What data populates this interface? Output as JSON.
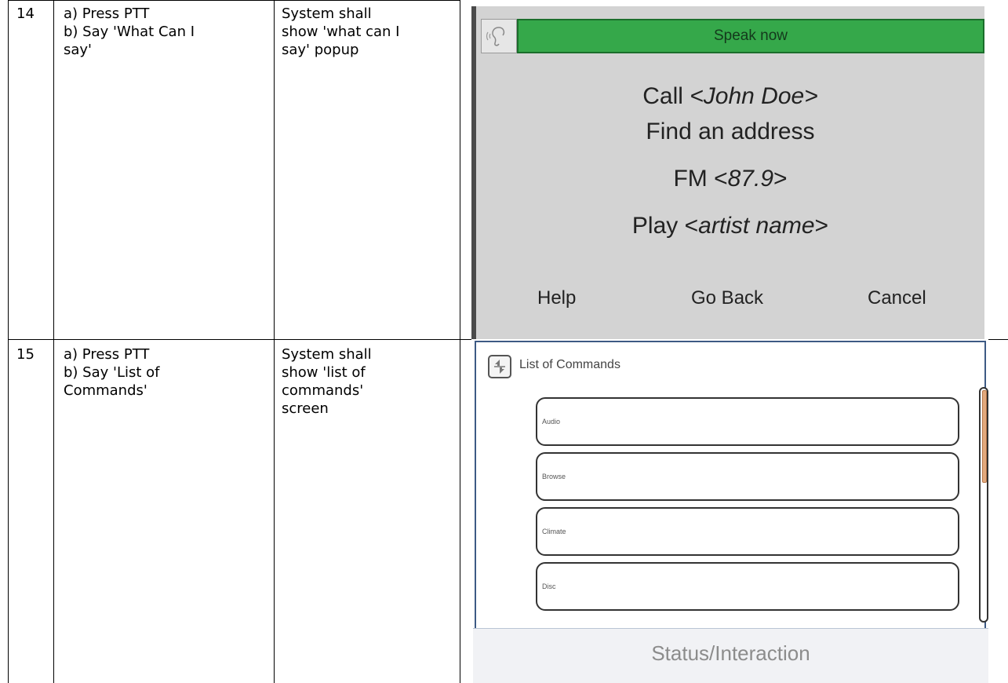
{
  "rows": [
    {
      "number": "14",
      "steps": [
        "a) Press PTT",
        "b) Say 'What Can I",
        "say'"
      ],
      "expected": [
        "System shall",
        "show 'what can I",
        "say' popup"
      ],
      "screen": {
        "banner": "Speak now",
        "commands": [
          {
            "prefix": "Call ",
            "italic": "<John Doe>",
            "suffix": ""
          },
          {
            "prefix": "Find an address",
            "italic": "",
            "suffix": ""
          },
          {
            "prefix": "FM <",
            "italic": "87.9",
            "suffix": ">"
          },
          {
            "prefix": "Play <",
            "italic": "artist name",
            "suffix": ">"
          }
        ],
        "buttons": {
          "help": "Help",
          "go_back": "Go Back",
          "cancel": "Cancel"
        }
      }
    },
    {
      "number": "15",
      "steps": [
        "a) Press PTT",
        "b) Say 'List of",
        "Commands'"
      ],
      "expected": [
        "System shall",
        "show 'list of",
        "commands'",
        "screen"
      ],
      "screen": {
        "title": "List of Commands",
        "items": [
          "Audio",
          "Browse",
          "Climate",
          "Disc"
        ],
        "status": "Status/Interaction"
      }
    }
  ],
  "colors": {
    "banner_green": "#35a84a",
    "popup_gray": "#d3d3d3",
    "frame_blue": "#3d5a84",
    "scroll_thumb": "#e2a97d"
  },
  "icons": {
    "row14": "ear-speaker-icon",
    "row15": "back-arrows-icon"
  }
}
